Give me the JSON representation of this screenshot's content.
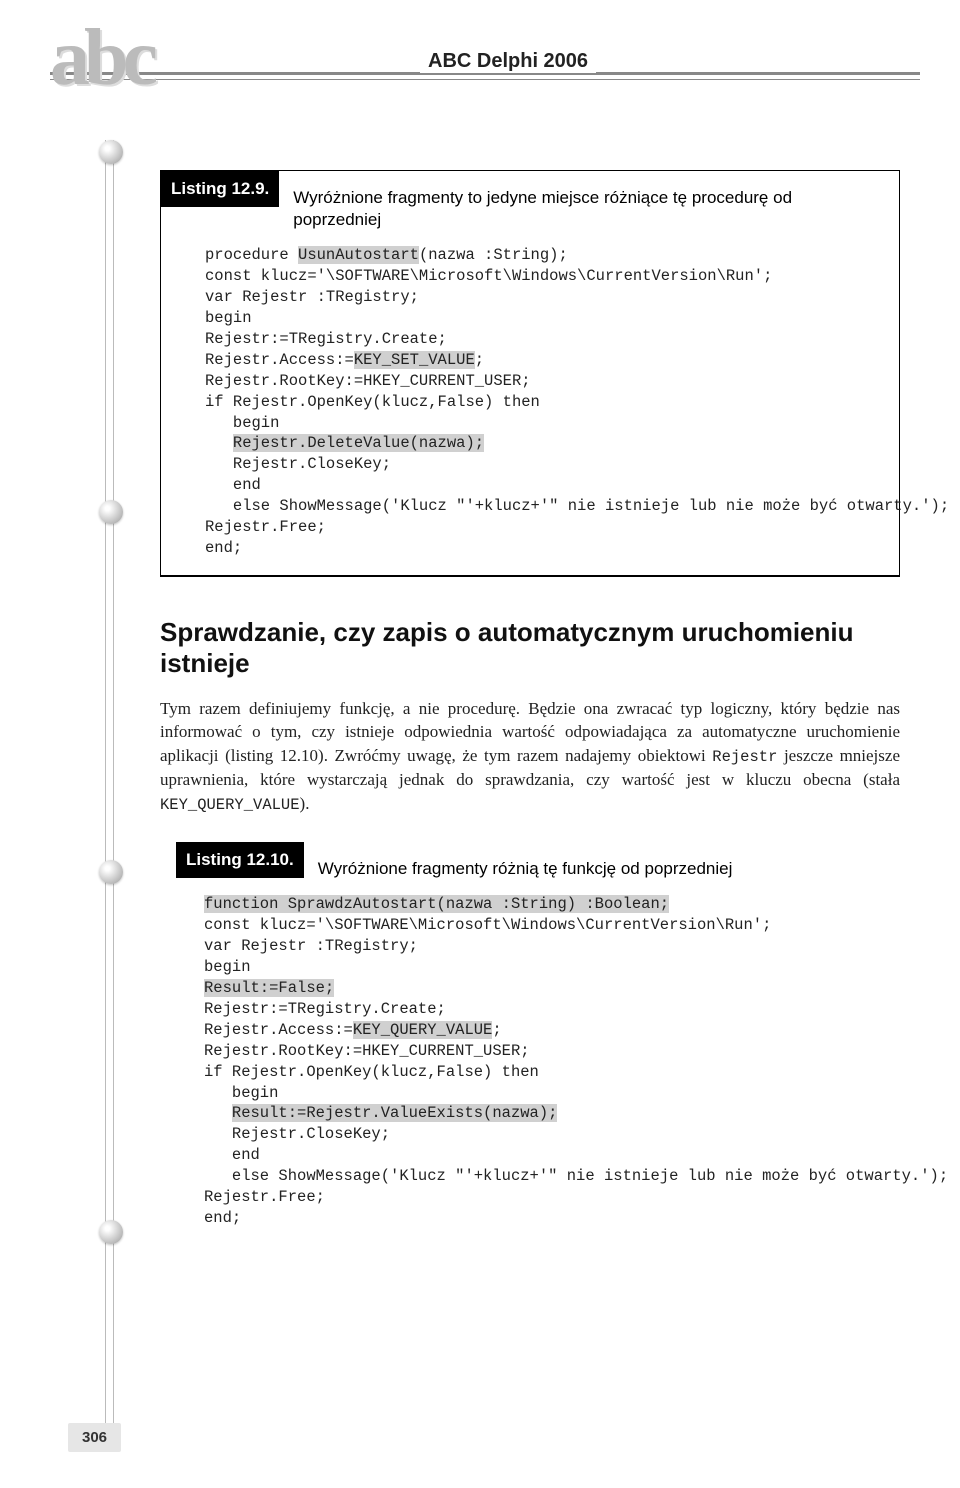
{
  "header": {
    "title": "ABC Delphi 2006",
    "logo": "abc"
  },
  "page_number": "306",
  "listing1": {
    "label": "Listing 12.9.",
    "caption": "Wyróżnione fragmenty to jedyne miejsce różniące tę procedurę od poprzedniej",
    "code": {
      "l01a": "procedure ",
      "l01b": "UsunAutostart",
      "l01c": "(nazwa :String);",
      "l02": "const klucz='\\SOFTWARE\\Microsoft\\Windows\\CurrentVersion\\Run';",
      "l03": "var Rejestr :TRegistry;",
      "l04": "begin",
      "l05": "Rejestr:=TRegistry.Create;",
      "l06a": "Rejestr.Access:=",
      "l06b": "KEY_SET_VALUE",
      "l06c": ";",
      "l07": "Rejestr.RootKey:=HKEY_CURRENT_USER;",
      "l08": "if Rejestr.OpenKey(klucz,False) then",
      "l09": "   begin",
      "l10a": "   ",
      "l10b": "Rejestr.DeleteValue(nazwa);",
      "l11": "   Rejestr.CloseKey;",
      "l12": "   end",
      "l13": "   else ShowMessage('Klucz \"'+klucz+'\" nie istnieje lub nie może być otwarty.');",
      "l14": "Rejestr.Free;",
      "l15": "end;"
    }
  },
  "section": {
    "heading": "Sprawdzanie, czy zapis o automatycznym uruchomieniu istnieje",
    "paragraph_a": "Tym razem definiujemy funkcję, a nie procedurę. Będzie ona zwracać typ logiczny, który będzie nas informować o tym, czy istnieje odpowiednia wartość odpowiadająca za automatyczne uruchomienie aplikacji (listing 12.10). Zwróćmy uwagę, że tym razem nadajemy obiektowi ",
    "mono1": "Rejestr",
    "paragraph_b": " jeszcze mniejsze uprawnienia, które wystarczają jednak do sprawdzania, czy wartość jest w kluczu obecna (stała ",
    "mono2": "KEY_QUERY_VALUE",
    "paragraph_c": ")."
  },
  "listing2": {
    "label": "Listing 12.10.",
    "caption": "Wyróżnione fragmenty różnią tę funkcję od poprzedniej",
    "code": {
      "l01": "function SprawdzAutostart(nazwa :String) :Boolean;",
      "l02": "const klucz='\\SOFTWARE\\Microsoft\\Windows\\CurrentVersion\\Run';",
      "l03": "var Rejestr :TRegistry;",
      "l04": "begin",
      "l05": "Result:=False;",
      "l06": "Rejestr:=TRegistry.Create;",
      "l07a": "Rejestr.Access:=",
      "l07b": "KEY_QUERY_VALUE",
      "l07c": ";",
      "l08": "Rejestr.RootKey:=HKEY_CURRENT_USER;",
      "l09": "if Rejestr.OpenKey(klucz,False) then",
      "l10": "   begin",
      "l11a": "   ",
      "l11b": "Result:=Rejestr.ValueExists(nazwa);",
      "l12": "   Rejestr.CloseKey;",
      "l13": "   end",
      "l14": "   else ShowMessage('Klucz \"'+klucz+'\" nie istnieje lub nie może być otwarty.');",
      "l15": "Rejestr.Free;",
      "l16": "end;"
    }
  }
}
